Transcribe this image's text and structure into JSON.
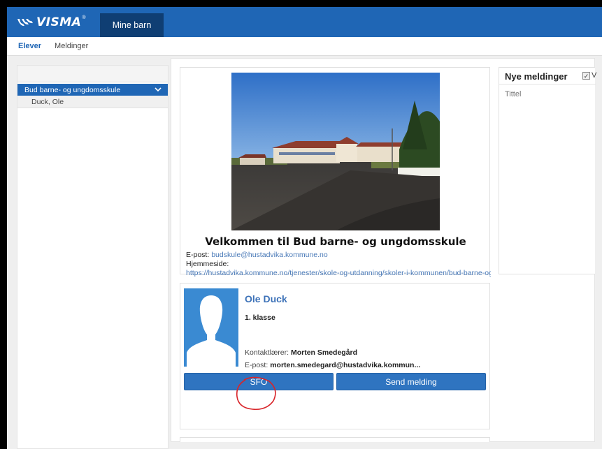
{
  "header": {
    "logo_text": "VISMA",
    "logo_mark": "®",
    "active_tab": "Mine barn",
    "brand_color": "#1f66b5"
  },
  "subnav": {
    "items": [
      {
        "label": "Elever",
        "active": true
      },
      {
        "label": "Meldinger",
        "active": false
      }
    ]
  },
  "sidebar": {
    "school": "Bud barne- og ungdomsskule",
    "student": "Duck, Ole"
  },
  "school_card": {
    "welcome": "Velkommen til Bud barne- og ungdomsskule",
    "email_label": "E-post:",
    "email": "budskule@hustadvika.kommune.no",
    "homepage_label": "Hjemmeside:",
    "homepage_url": "https://hustadvika.kommune.no/tjenester/skole-og-utdanning/skoler-i-kommunen/bud-barne-og-ungdomsskule"
  },
  "messages": {
    "title": "Nye meldinger",
    "checkbox_label": "V",
    "column": "Tittel"
  },
  "student_card": {
    "name": "Ole Duck",
    "class": "1. klasse",
    "contact_teacher_label": "Kontaktlærer:",
    "contact_teacher": "Morten Smedegård",
    "email_label": "E-post:",
    "email": "morten.smedegard@hustadvika.kommun...",
    "sfo_button": "SFO",
    "send_button": "Send melding"
  }
}
